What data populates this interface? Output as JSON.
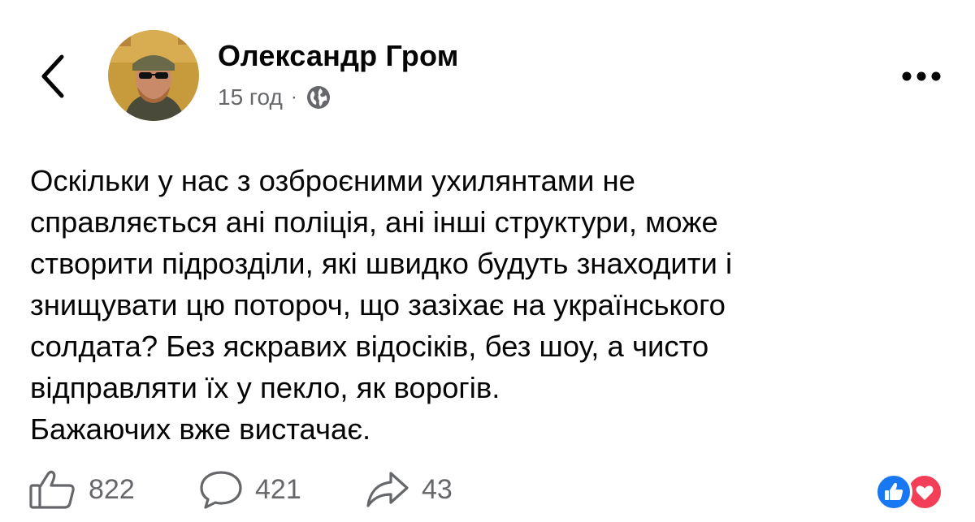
{
  "post": {
    "author": "Олександр Гром",
    "time": "15 год",
    "separator": "·",
    "privacy_icon": "globe-icon",
    "text_lines": [
      "Оскільки у нас з озброєними ухилянтами не",
      "справляється ані поліція, ані інші структури, може",
      "створити підрозділи, які швидко будуть знаходити і",
      "знищувати цю потороч, що зазіхає на українського",
      "солдата? Без яскравих відосіків, без шоу, а чисто",
      "відправляти їх у пекло, як ворогів.",
      "Бажаючих вже вистачає."
    ]
  },
  "actions": {
    "like_count": "822",
    "comment_count": "421",
    "share_count": "43"
  },
  "reactions": [
    "like",
    "love"
  ],
  "colors": {
    "text": "#050505",
    "secondary": "#65676b",
    "like_blue": "#1877f2",
    "love_red": "#f33e58"
  }
}
